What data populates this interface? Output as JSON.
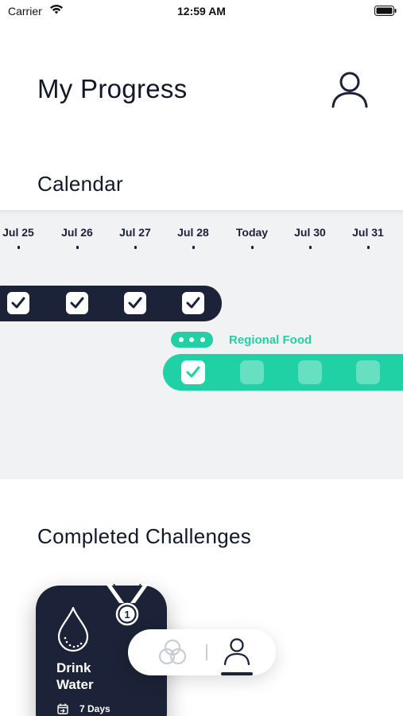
{
  "status_bar": {
    "carrier": "Carrier",
    "time": "12:59 AM"
  },
  "header": {
    "title": "My Progress",
    "profile_icon": "person-outline-icon"
  },
  "calendar": {
    "title": "Calendar",
    "days": [
      "Jul 25",
      "Jul 26",
      "Jul 27",
      "Jul 28",
      "Today",
      "Jul 30",
      "Jul 31"
    ],
    "dark_track": {
      "completed_days": [
        "Jul 25",
        "Jul 26",
        "Jul 27",
        "Jul 28"
      ]
    },
    "challenge": {
      "name": "Regional Food",
      "badge_icon": "more-dots-icon",
      "completed_days": [
        "Jul 28"
      ],
      "pending_days": [
        "Today",
        "Jul 30",
        "Jul 31"
      ]
    }
  },
  "completed": {
    "title": "Completed Challenges",
    "cards": [
      {
        "name": "Drink Water",
        "duration": "7 Days",
        "medal_rank": "1",
        "icon": "water-drop-icon"
      }
    ]
  },
  "tabbar": {
    "tabs": [
      {
        "icon": "challenges-rings-icon",
        "active": false
      },
      {
        "icon": "profile-icon",
        "active": true
      }
    ]
  },
  "colors": {
    "accent_green": "#1fd1a4",
    "navy": "#1c2237",
    "calendar_bg": "#f1f2f4"
  }
}
